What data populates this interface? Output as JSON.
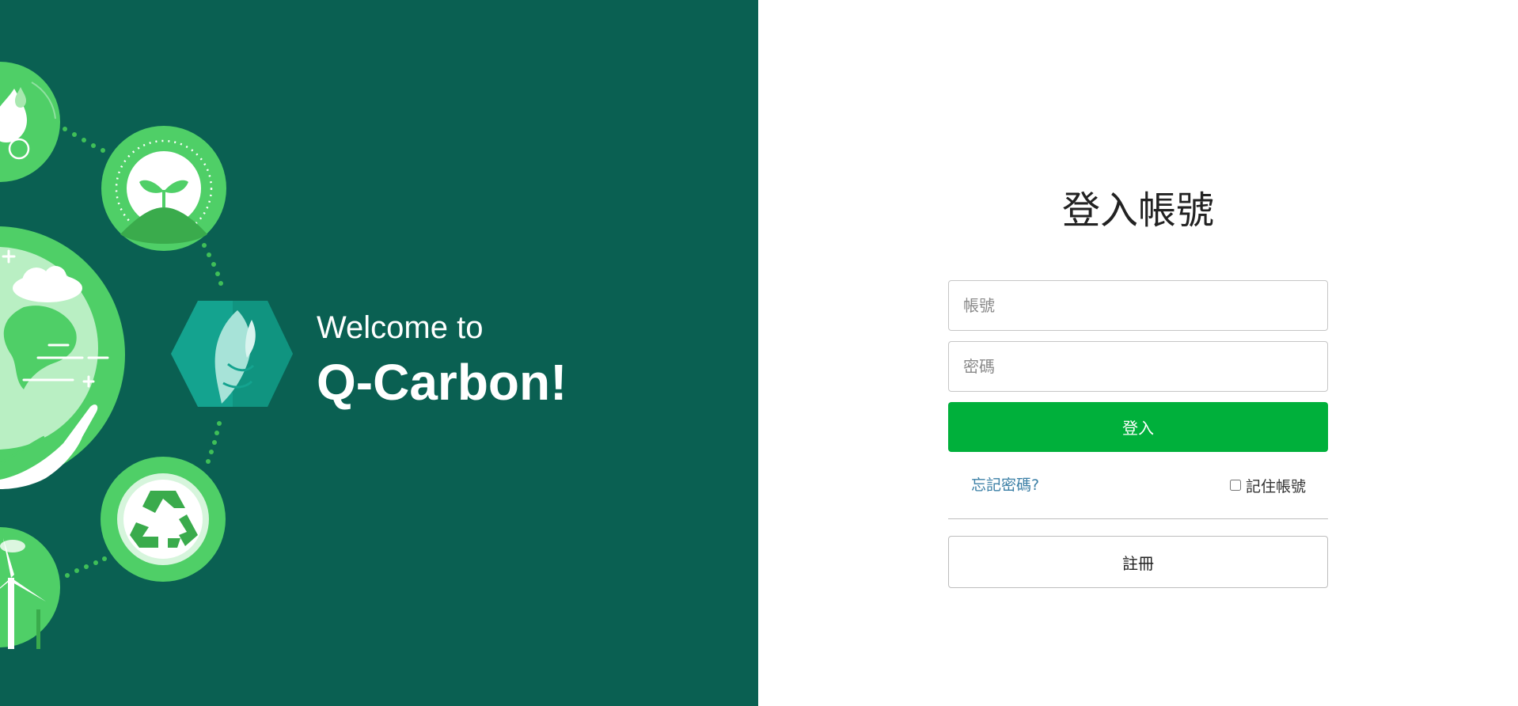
{
  "welcome": {
    "line1": "Welcome to",
    "line2": "Q-Carbon!"
  },
  "icons": [
    "water-drop-icon",
    "sprout-icon",
    "earth-hand-icon",
    "leaf-logo-icon",
    "recycle-icon",
    "wind-turbine-icon"
  ],
  "colors": {
    "panel_bg": "#0a6052",
    "circle_green": "#4fcf67",
    "logo_teal": "#14a38f",
    "login_button": "#00b03b",
    "link": "#3b7fa6"
  },
  "login": {
    "title": "登入帳號",
    "account_placeholder": "帳號",
    "password_placeholder": "密碼",
    "login_label": "登入",
    "forgot_label": "忘記密碼?",
    "remember_label": "記住帳號",
    "register_label": "註冊"
  }
}
